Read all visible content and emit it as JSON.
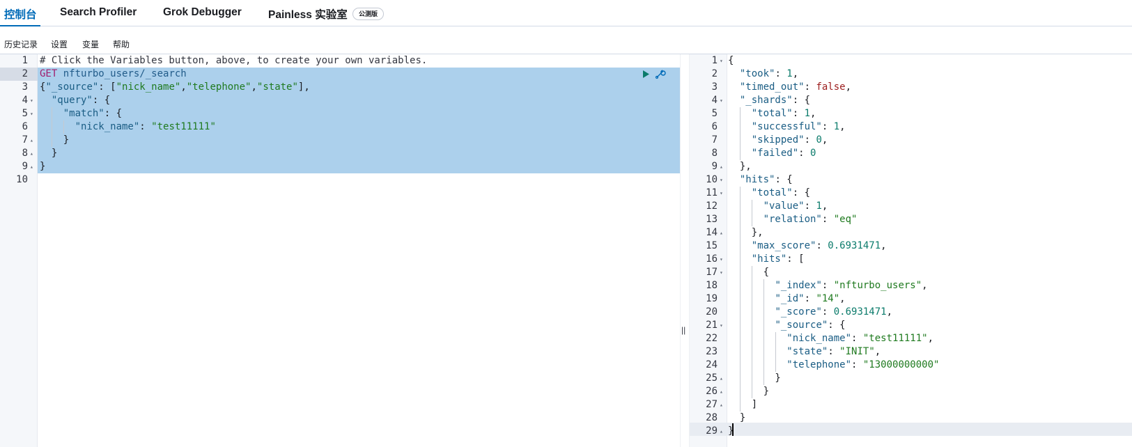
{
  "tabs": [
    {
      "label": "控制台",
      "active": true
    },
    {
      "label": "Search Profiler",
      "active": false
    },
    {
      "label": "Grok Debugger",
      "active": false
    },
    {
      "label": "Painless 实验室",
      "active": false
    }
  ],
  "beta_badge": "公测版",
  "menu": [
    "历史记录",
    "设置",
    "变量",
    "帮助"
  ],
  "request": {
    "comment": "# Click the Variables button, above, to create your own variables.",
    "method": "GET",
    "path": "nfturbo_users/_search",
    "line_count": 10,
    "fold_lines": [
      4,
      5,
      7,
      8,
      9
    ]
  },
  "response": {
    "line_count": 29,
    "took": "1",
    "timed_out": "false",
    "shards_total": "1",
    "shards_successful": "1",
    "shards_skipped": "0",
    "shards_failed": "0",
    "hits_total_value": "1",
    "hits_total_relation": "\"eq\"",
    "max_score": "0.6931471",
    "hit_index": "\"nfturbo_users\"",
    "hit_id": "\"14\"",
    "hit_score": "0.6931471",
    "src_nick_name": "\"test11111\"",
    "src_state": "\"INIT\"",
    "src_telephone": "\"13000000000\""
  },
  "icons": {
    "run": "play-icon",
    "wrench": "wrench-icon",
    "resize": "resize-handle-icon"
  },
  "colors": {
    "accent": "#006bb8",
    "selection": "#acd0ec"
  }
}
